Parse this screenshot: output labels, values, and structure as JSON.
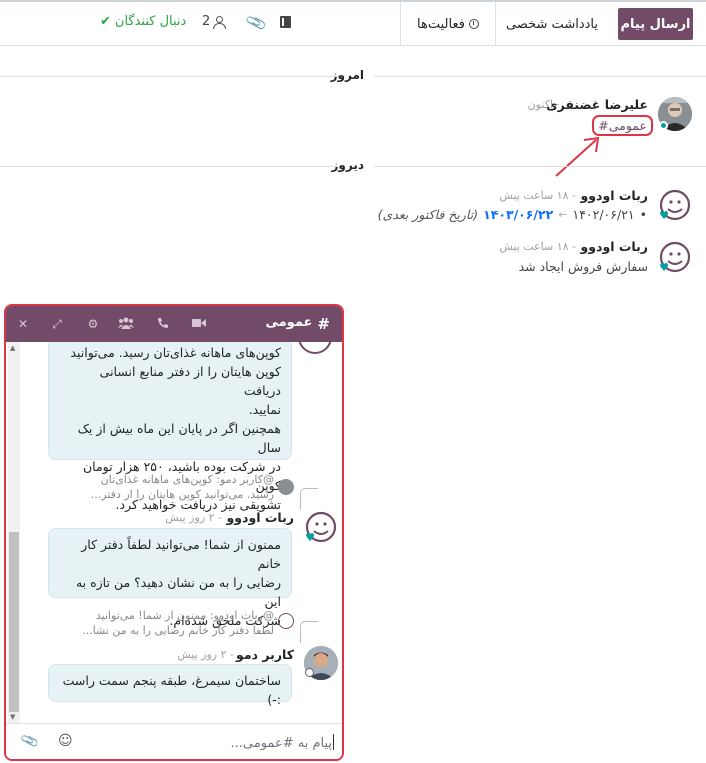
{
  "topbar": {
    "send_label": "ارسال پیام",
    "note_label": "یادداشت شخصی",
    "activities_label": "فعالیت‌ها",
    "followers_count": "2",
    "follow_label": "دنبال کنندگان"
  },
  "today_label": "امروز",
  "yesterday_label": "دیروز",
  "msg1": {
    "author": "علیرضا غضنفری",
    "time": "· اکنون",
    "hashtag": "#عمومی"
  },
  "msg2": {
    "author": "ربات اودوو",
    "time": "- ۱۸ ساعت پیش",
    "old_value": "۱۴۰۲/۰۶/۲۱",
    "new_value": "۱۴۰۳/۰۶/۲۲",
    "field": "(تاریخ فاکتور بعدی)"
  },
  "msg3": {
    "author": "ربات اودوو",
    "time": "- ۱۸ ساعت پیش",
    "body": "سفارش فروش ایجاد شد"
  },
  "chat": {
    "title": "عمومی",
    "top_bubble": [
      "کوپن‌های ماهانه غذای‌تان رسید. می‌توانید",
      "کوپن هایتان را از دفتر منابع انسانی دریافت",
      "نمایید.",
      "همچنین اگر در پایان این ماه بیش از یک سال",
      "در شرکت بوده باشید، ۲۵۰ هزار تومان کوپن",
      "تشویقی نیز دریافت خواهید کرد."
    ],
    "reply1": [
      "@کاربر دمو:  کوپن‌های ماهانه غذای‌تان",
      "رسید. می‌توانید کوپن هایتان را از دفتر..."
    ],
    "bot_author": "ربات اودوو",
    "bot_time": "- ۲ روز پیش",
    "bot_bubble": [
      "ممنون از شما! می‌توانید لطفاً دفتر کار خانم",
      "رضایی را به من نشان دهید؟ من تازه به این",
      "شرکت ملحق شده‌ام."
    ],
    "reply2": [
      "@ربات اودوو:  ممنون از شما! می‌توانید",
      "لطفاً دفتر کار خانم رضایی را به من نشا..."
    ],
    "demo_author": "کاربر دمو",
    "demo_time": "- ۲ روز پیش",
    "demo_bubble": "ساختمان سیمرغ، طبقه پنجم سمت راست :-)",
    "composer_placeholder": "پیام به #عمومی..."
  },
  "colors": {
    "brand": "#714b67",
    "highlight": "#dc3545",
    "online": "#00a09d",
    "bubble": "#e6f2f3"
  }
}
